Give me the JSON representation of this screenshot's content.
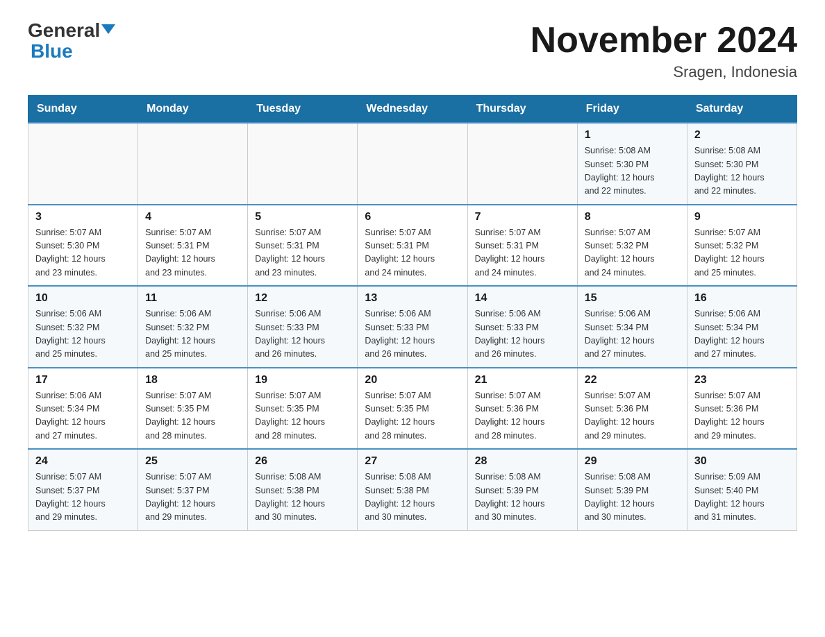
{
  "header": {
    "logo_general": "General",
    "logo_blue": "Blue",
    "month_title": "November 2024",
    "location": "Sragen, Indonesia"
  },
  "days_of_week": [
    "Sunday",
    "Monday",
    "Tuesday",
    "Wednesday",
    "Thursday",
    "Friday",
    "Saturday"
  ],
  "weeks": [
    {
      "days": [
        {
          "number": "",
          "info": ""
        },
        {
          "number": "",
          "info": ""
        },
        {
          "number": "",
          "info": ""
        },
        {
          "number": "",
          "info": ""
        },
        {
          "number": "",
          "info": ""
        },
        {
          "number": "1",
          "info": "Sunrise: 5:08 AM\nSunset: 5:30 PM\nDaylight: 12 hours\nand 22 minutes."
        },
        {
          "number": "2",
          "info": "Sunrise: 5:08 AM\nSunset: 5:30 PM\nDaylight: 12 hours\nand 22 minutes."
        }
      ]
    },
    {
      "days": [
        {
          "number": "3",
          "info": "Sunrise: 5:07 AM\nSunset: 5:30 PM\nDaylight: 12 hours\nand 23 minutes."
        },
        {
          "number": "4",
          "info": "Sunrise: 5:07 AM\nSunset: 5:31 PM\nDaylight: 12 hours\nand 23 minutes."
        },
        {
          "number": "5",
          "info": "Sunrise: 5:07 AM\nSunset: 5:31 PM\nDaylight: 12 hours\nand 23 minutes."
        },
        {
          "number": "6",
          "info": "Sunrise: 5:07 AM\nSunset: 5:31 PM\nDaylight: 12 hours\nand 24 minutes."
        },
        {
          "number": "7",
          "info": "Sunrise: 5:07 AM\nSunset: 5:31 PM\nDaylight: 12 hours\nand 24 minutes."
        },
        {
          "number": "8",
          "info": "Sunrise: 5:07 AM\nSunset: 5:32 PM\nDaylight: 12 hours\nand 24 minutes."
        },
        {
          "number": "9",
          "info": "Sunrise: 5:07 AM\nSunset: 5:32 PM\nDaylight: 12 hours\nand 25 minutes."
        }
      ]
    },
    {
      "days": [
        {
          "number": "10",
          "info": "Sunrise: 5:06 AM\nSunset: 5:32 PM\nDaylight: 12 hours\nand 25 minutes."
        },
        {
          "number": "11",
          "info": "Sunrise: 5:06 AM\nSunset: 5:32 PM\nDaylight: 12 hours\nand 25 minutes."
        },
        {
          "number": "12",
          "info": "Sunrise: 5:06 AM\nSunset: 5:33 PM\nDaylight: 12 hours\nand 26 minutes."
        },
        {
          "number": "13",
          "info": "Sunrise: 5:06 AM\nSunset: 5:33 PM\nDaylight: 12 hours\nand 26 minutes."
        },
        {
          "number": "14",
          "info": "Sunrise: 5:06 AM\nSunset: 5:33 PM\nDaylight: 12 hours\nand 26 minutes."
        },
        {
          "number": "15",
          "info": "Sunrise: 5:06 AM\nSunset: 5:34 PM\nDaylight: 12 hours\nand 27 minutes."
        },
        {
          "number": "16",
          "info": "Sunrise: 5:06 AM\nSunset: 5:34 PM\nDaylight: 12 hours\nand 27 minutes."
        }
      ]
    },
    {
      "days": [
        {
          "number": "17",
          "info": "Sunrise: 5:06 AM\nSunset: 5:34 PM\nDaylight: 12 hours\nand 27 minutes."
        },
        {
          "number": "18",
          "info": "Sunrise: 5:07 AM\nSunset: 5:35 PM\nDaylight: 12 hours\nand 28 minutes."
        },
        {
          "number": "19",
          "info": "Sunrise: 5:07 AM\nSunset: 5:35 PM\nDaylight: 12 hours\nand 28 minutes."
        },
        {
          "number": "20",
          "info": "Sunrise: 5:07 AM\nSunset: 5:35 PM\nDaylight: 12 hours\nand 28 minutes."
        },
        {
          "number": "21",
          "info": "Sunrise: 5:07 AM\nSunset: 5:36 PM\nDaylight: 12 hours\nand 28 minutes."
        },
        {
          "number": "22",
          "info": "Sunrise: 5:07 AM\nSunset: 5:36 PM\nDaylight: 12 hours\nand 29 minutes."
        },
        {
          "number": "23",
          "info": "Sunrise: 5:07 AM\nSunset: 5:36 PM\nDaylight: 12 hours\nand 29 minutes."
        }
      ]
    },
    {
      "days": [
        {
          "number": "24",
          "info": "Sunrise: 5:07 AM\nSunset: 5:37 PM\nDaylight: 12 hours\nand 29 minutes."
        },
        {
          "number": "25",
          "info": "Sunrise: 5:07 AM\nSunset: 5:37 PM\nDaylight: 12 hours\nand 29 minutes."
        },
        {
          "number": "26",
          "info": "Sunrise: 5:08 AM\nSunset: 5:38 PM\nDaylight: 12 hours\nand 30 minutes."
        },
        {
          "number": "27",
          "info": "Sunrise: 5:08 AM\nSunset: 5:38 PM\nDaylight: 12 hours\nand 30 minutes."
        },
        {
          "number": "28",
          "info": "Sunrise: 5:08 AM\nSunset: 5:39 PM\nDaylight: 12 hours\nand 30 minutes."
        },
        {
          "number": "29",
          "info": "Sunrise: 5:08 AM\nSunset: 5:39 PM\nDaylight: 12 hours\nand 30 minutes."
        },
        {
          "number": "30",
          "info": "Sunrise: 5:09 AM\nSunset: 5:40 PM\nDaylight: 12 hours\nand 31 minutes."
        }
      ]
    }
  ]
}
